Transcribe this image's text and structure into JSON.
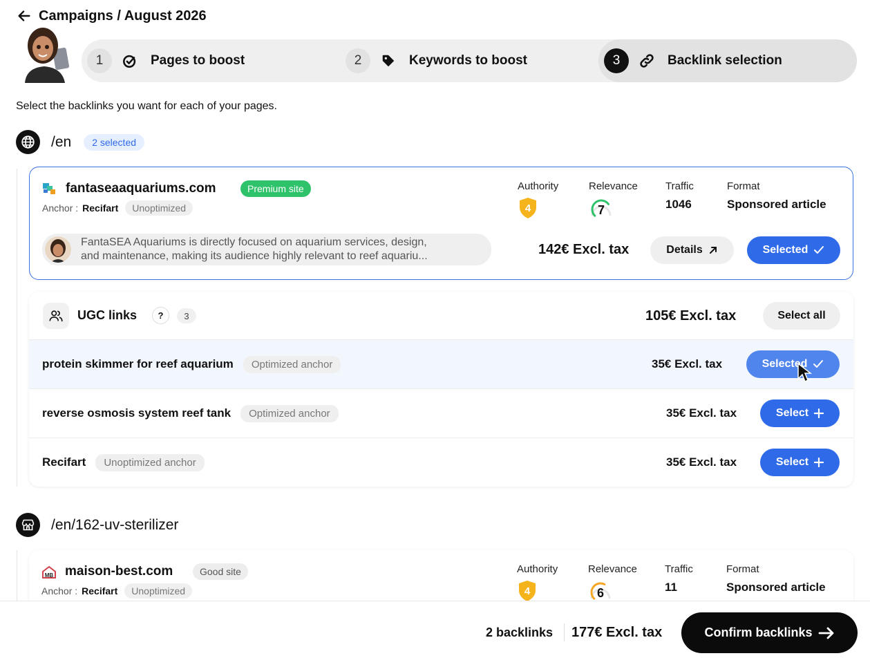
{
  "header": {
    "breadcrumb": "Campaigns / August 2026"
  },
  "steps": [
    {
      "num": "1",
      "label": "Pages to boost"
    },
    {
      "num": "2",
      "label": "Keywords to boost"
    },
    {
      "num": "3",
      "label": "Backlink selection"
    }
  ],
  "intro": "Select the backlinks you want for each of your pages.",
  "page1": {
    "path": "/en",
    "selected_badge": "2 selected",
    "site": {
      "name": "fantaseaaquariums.com",
      "badge": "Premium site",
      "anchor_label": "Anchor :",
      "anchor_value": "Recifart",
      "anchor_tag": "Unoptimized",
      "authority_label": "Authority",
      "authority_value": "4",
      "relevance_label": "Relevance",
      "relevance_value": "7",
      "traffic_label": "Traffic",
      "traffic_value": "1046",
      "format_label": "Format",
      "format_value": "Sponsored article",
      "description_line1": "FantaSEA Aquariums is directly focused on aquarium services, design,",
      "description_line2": "and maintenance, making its audience highly relevant to reef aquariu...",
      "price": "142€ Excl. tax",
      "details_label": "Details",
      "selected_label": "Selected"
    },
    "ugc": {
      "title": "UGC links",
      "help": "?",
      "count": "3",
      "total_price": "105€ Excl. tax",
      "select_all_label": "Select all",
      "rows": [
        {
          "keyword": "protein skimmer for reef aquarium",
          "tag": "Optimized anchor",
          "price": "35€ Excl. tax",
          "button": "Selected"
        },
        {
          "keyword": "reverse osmosis system reef tank",
          "tag": "Optimized anchor",
          "price": "35€ Excl. tax",
          "button": "Select"
        },
        {
          "keyword": "Recifart",
          "tag": "Unoptimized anchor",
          "price": "35€ Excl. tax",
          "button": "Select"
        }
      ]
    }
  },
  "page2": {
    "path": "/en/162-uv-sterilizer",
    "site": {
      "name": "maison-best.com",
      "badge": "Good site",
      "anchor_label": "Anchor :",
      "anchor_value": "Recifart",
      "anchor_tag": "Unoptimized",
      "authority_label": "Authority",
      "authority_value": "4",
      "relevance_label": "Relevance",
      "relevance_value": "6",
      "traffic_label": "Traffic",
      "traffic_value": "11",
      "format_label": "Format",
      "format_value": "Sponsored article"
    }
  },
  "footer": {
    "count": "2 backlinks",
    "total": "177€ Excl. tax",
    "confirm_label": "Confirm backlinks"
  },
  "icons": {
    "back": "arrow-left-icon",
    "step1": "target-check-icon",
    "step2": "tag-icon",
    "step3": "link-icon",
    "page1": "globe-icon",
    "page2": "store-icon",
    "ugc": "users-icon"
  },
  "colors": {
    "accent": "#2f6ae8",
    "premium": "#2ec26a",
    "authority": "#f5b31c",
    "relevance_high": "#2ec26a",
    "relevance_mid": "#f5a623"
  },
  "relevance_scores": {
    "page1": 0.7,
    "page2": 0.6
  }
}
